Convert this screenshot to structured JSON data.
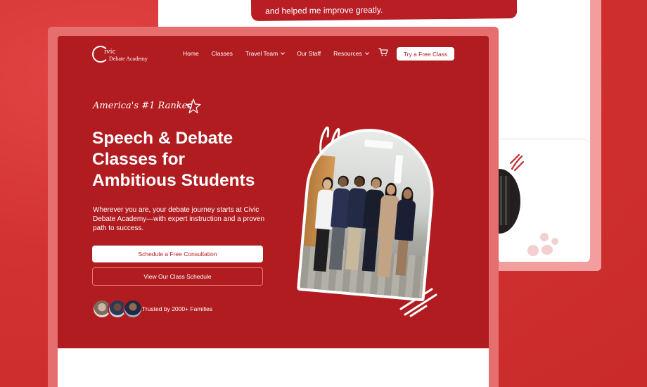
{
  "quote_snippet": "and helped me improve greatly.",
  "logo": {
    "line1": "ivic",
    "line2": "Debate Academy"
  },
  "nav": {
    "items": [
      {
        "label": "Home",
        "dropdown": false
      },
      {
        "label": "Classes",
        "dropdown": false
      },
      {
        "label": "Travel Team",
        "dropdown": true
      },
      {
        "label": "Our Staff",
        "dropdown": false
      },
      {
        "label": "Resources",
        "dropdown": true
      }
    ],
    "cart_icon": "cart-icon",
    "cta_label": "Try a Free Class"
  },
  "hero": {
    "tagline": "America's #1 Ranked",
    "headline_lines": [
      "Speech & Debate",
      "Classes for",
      "Ambitious Students"
    ],
    "description": "Wherever you are, your debate journey starts at Civic Debate Academy—with expert instruction and a proven path to success.",
    "primary_button": "Schedule a Free Consultation",
    "secondary_button": "View Our Class Schedule",
    "trusted_text": "Trusted by 2000+ Families"
  },
  "colors": {
    "brand_red": "#b11c21",
    "background_red": "#d23232",
    "white": "#ffffff"
  }
}
